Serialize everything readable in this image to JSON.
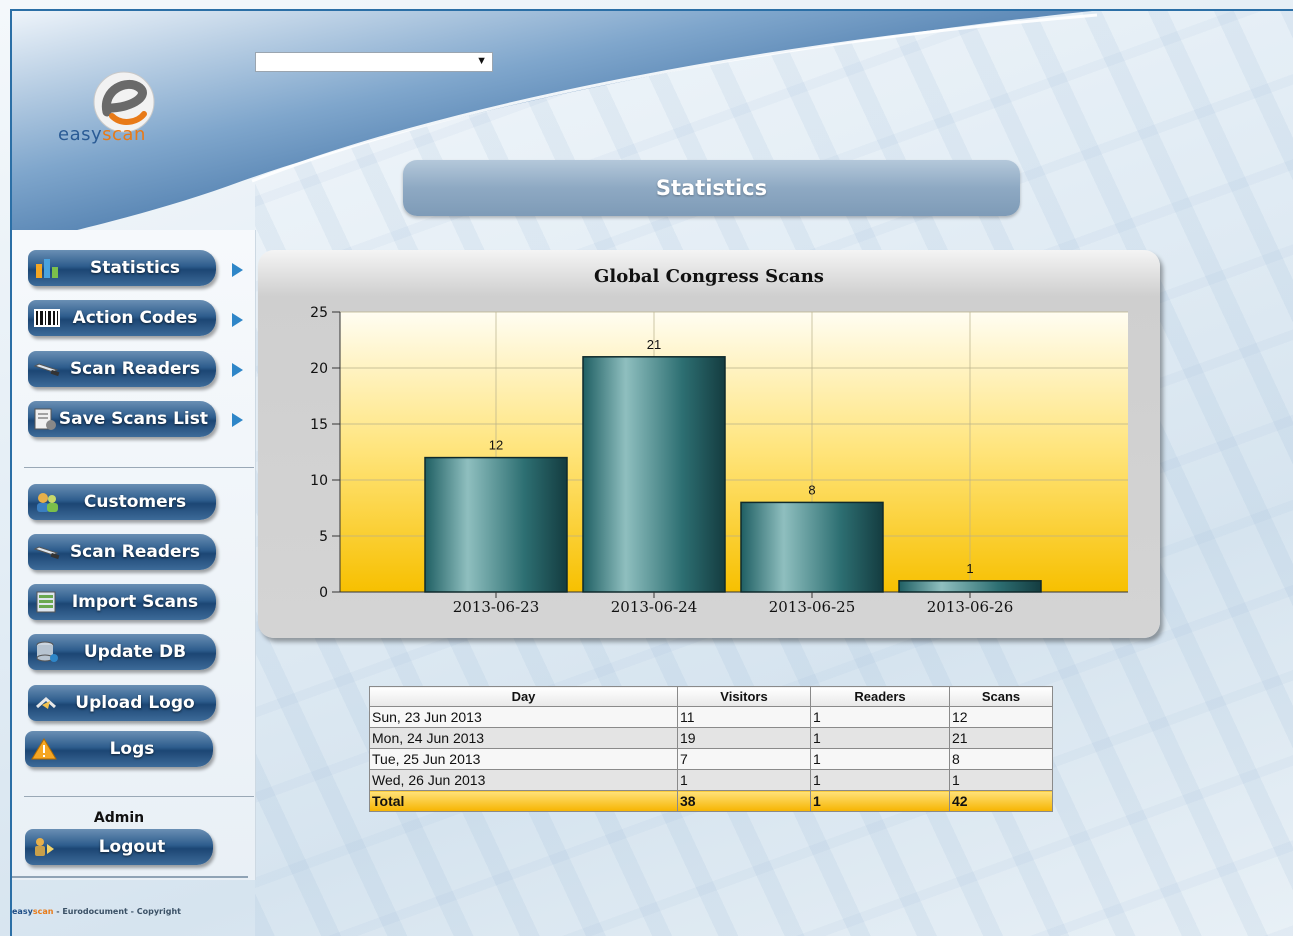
{
  "app": {
    "brand_primary": "easy",
    "brand_secondary": "scan"
  },
  "header": {
    "project_select_value": "",
    "page_title": "Statistics"
  },
  "sidebar": {
    "primary_items": [
      {
        "label": "Statistics",
        "icon": "bar-chart-icon"
      },
      {
        "label": "Action Codes",
        "icon": "barcode-icon"
      },
      {
        "label": "Scan Readers",
        "icon": "scanner-icon"
      },
      {
        "label": "Save Scans List",
        "icon": "save-list-icon"
      }
    ],
    "secondary_items": [
      {
        "label": "Customers",
        "icon": "customers-icon"
      },
      {
        "label": "Scan Readers",
        "icon": "scanner-icon"
      },
      {
        "label": "Import Scans",
        "icon": "import-icon"
      },
      {
        "label": "Update DB",
        "icon": "database-icon"
      },
      {
        "label": "Upload Logo",
        "icon": "upload-icon"
      },
      {
        "label": "Logs",
        "icon": "warning-icon"
      }
    ],
    "user_label": "Admin",
    "logout_label": "Logout"
  },
  "footer": {
    "brand_a": "easy",
    "brand_b": "scan",
    "text": " - Eurodocument - Copyright"
  },
  "chart_data": {
    "type": "bar",
    "title": "Global Congress Scans",
    "categories": [
      "2013-06-23",
      "2013-06-24",
      "2013-06-25",
      "2013-06-26"
    ],
    "values": [
      12,
      21,
      8,
      1
    ],
    "ylim": [
      0,
      25
    ],
    "yticks": [
      0,
      5,
      10,
      15,
      20,
      25
    ],
    "grid": true,
    "bar_color": "#2f7c80"
  },
  "table": {
    "headers": [
      "Day",
      "Visitors",
      "Readers",
      "Scans"
    ],
    "rows": [
      [
        "Sun, 23 Jun 2013",
        "11",
        "1",
        "12"
      ],
      [
        "Mon, 24 Jun 2013",
        "19",
        "1",
        "21"
      ],
      [
        "Tue, 25 Jun 2013",
        "7",
        "1",
        "8"
      ],
      [
        "Wed, 26 Jun 2013",
        "1",
        "1",
        "1"
      ]
    ],
    "total": [
      "Total",
      "38",
      "1",
      "42"
    ]
  },
  "colors": {
    "accent_blue": "#1f4e86",
    "accent_orange": "#e87a18",
    "total_row": "#f6b400"
  }
}
